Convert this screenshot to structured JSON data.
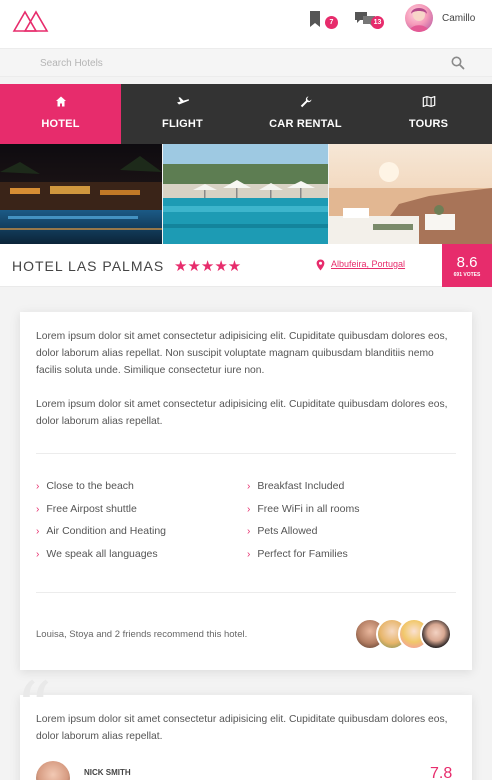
{
  "header": {
    "bookmarks_count": "7",
    "messages_count": "13",
    "user_name": "Camillo"
  },
  "search": {
    "placeholder": "Search Hotels"
  },
  "nav": {
    "tabs": [
      {
        "label": "HOTEL",
        "icon": "home-icon",
        "active": true
      },
      {
        "label": "FLIGHT",
        "icon": "plane-icon",
        "active": false
      },
      {
        "label": "CAR RENTAL",
        "icon": "wrench-icon",
        "active": false
      },
      {
        "label": "TOURS",
        "icon": "map-icon",
        "active": false
      }
    ]
  },
  "hotel": {
    "name": "HOTEL LAS PALMAS",
    "stars": "★★★★★",
    "location": "Albufeira, Portugal",
    "rating": "8.6",
    "votes": "691 VOTES"
  },
  "description": {
    "paragraphs": [
      "Lorem ipsum dolor sit amet consectetur adipisicing elit. Cupiditate quibusdam dolores eos, dolor laborum alias repellat. Non suscipit voluptate magnam quibusdam blanditiis nemo facilis soluta unde. Similique consectetur iure non.",
      "Lorem ipsum dolor sit amet consectetur adipisicing elit. Cupiditate quibusdam dolores eos, dolor laborum alias repellat."
    ]
  },
  "amenities": [
    "Close to the beach",
    "Breakfast Included",
    "Free Airpost shuttle",
    "Free WiFi in all rooms",
    "Air Condition and Heating",
    "Pets Allowed",
    "We speak all languages",
    "Perfect for Families"
  ],
  "recommendation": {
    "text": "Louisa, Stoya and 2 friends recommend this hotel."
  },
  "review": {
    "text": "Lorem ipsum dolor sit amet consectetur adipisicing elit. Cupiditate quibusdam dolores eos, dolor laborum alias repellat.",
    "author": "NICK SMITH",
    "score": "7.8"
  },
  "colors": {
    "accent": "#e72c6c",
    "nav_bg": "#333333"
  }
}
